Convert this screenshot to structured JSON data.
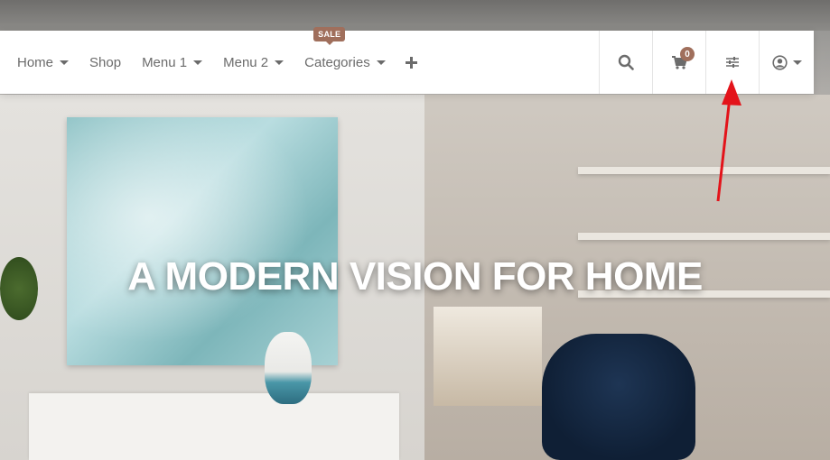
{
  "nav": {
    "items": [
      {
        "label": "Home",
        "has_dropdown": true
      },
      {
        "label": "Shop",
        "has_dropdown": false
      },
      {
        "label": "Menu 1",
        "has_dropdown": true
      },
      {
        "label": "Menu 2",
        "has_dropdown": true
      },
      {
        "label": "Categories",
        "has_dropdown": true,
        "badge": "SALE"
      }
    ],
    "plus_icon": "plus-icon",
    "right_icons": [
      "search-icon",
      "cart-icon",
      "sliders-icon",
      "user-circle-icon"
    ],
    "cart_count": "0"
  },
  "hero": {
    "title": "A MODERN VISION FOR HOME"
  },
  "colors": {
    "accent": "#a06f5c",
    "nav_text": "#6b6b6b",
    "arrow": "#e3131a"
  }
}
